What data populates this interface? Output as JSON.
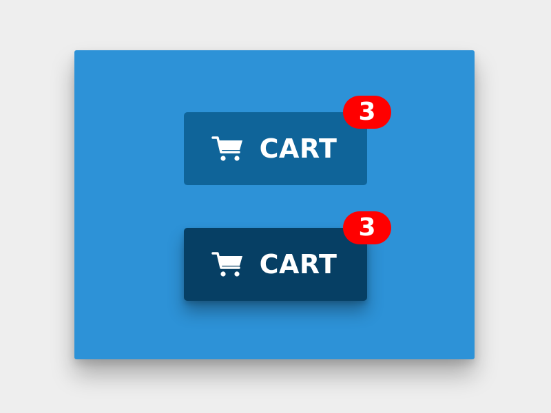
{
  "colors": {
    "page_background": "#eeeeee",
    "panel_background": "#2d92d7",
    "button_default": "#0f6499",
    "button_hover": "#063f64",
    "badge": "#ff0000",
    "text": "#ffffff"
  },
  "buttons": [
    {
      "label": "CART",
      "icon": "shopping-cart-icon",
      "badge_count": "3",
      "state": "default"
    },
    {
      "label": "CART",
      "icon": "shopping-cart-icon",
      "badge_count": "3",
      "state": "hover"
    }
  ]
}
